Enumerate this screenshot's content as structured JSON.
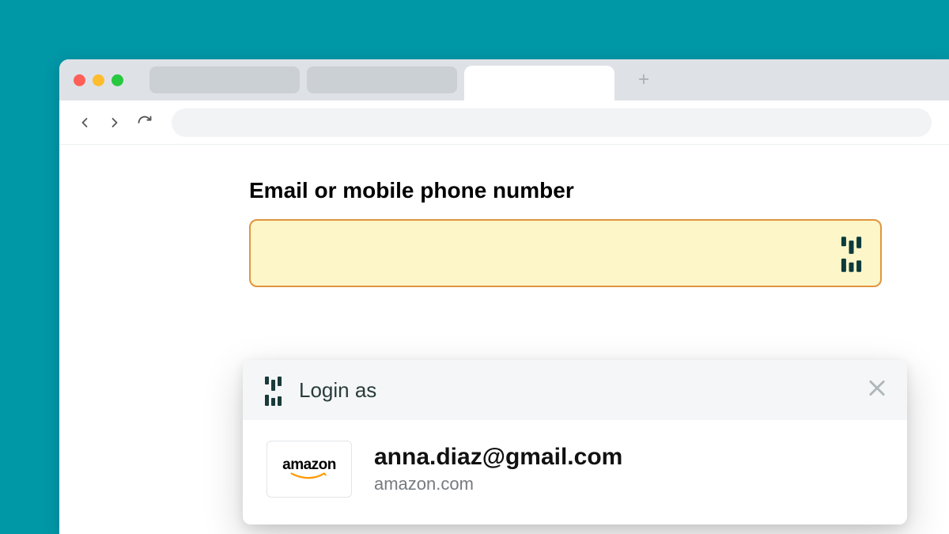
{
  "form": {
    "field_label": "Email or mobile phone number"
  },
  "popup": {
    "title": "Login as",
    "credential": {
      "email": "anna.diaz@gmail.com",
      "domain": "amazon.com",
      "site_name": "amazon"
    }
  }
}
